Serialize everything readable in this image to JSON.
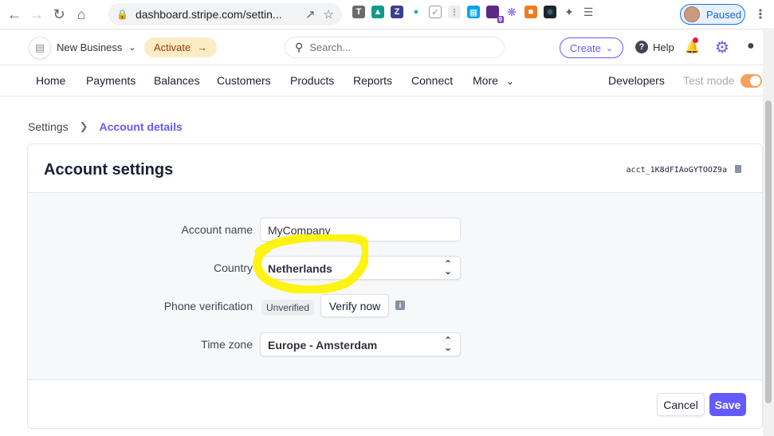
{
  "browser": {
    "url": "dashboard.stripe.com/settin...",
    "profile_status": "Paused",
    "extension_badge": "9"
  },
  "topbar": {
    "business_name": "New Business",
    "activate_label": "Activate",
    "search_placeholder": "Search...",
    "create_label": "Create",
    "help_label": "Help"
  },
  "nav": {
    "items": [
      "Home",
      "Payments",
      "Balances",
      "Customers",
      "Products",
      "Reports",
      "Connect",
      "More"
    ],
    "developers_label": "Developers",
    "test_mode_label": "Test mode"
  },
  "breadcrumb": {
    "parent": "Settings",
    "current": "Account details"
  },
  "card": {
    "title": "Account settings",
    "account_id": "acct_1K8dFIAoGYTOOZ9a",
    "fields": {
      "account_name_label": "Account name",
      "account_name_value": "MyCompany",
      "country_label": "Country",
      "country_value": "Netherlands",
      "phone_label": "Phone verification",
      "phone_status": "Unverified",
      "verify_label": "Verify now",
      "timezone_label": "Time zone",
      "timezone_value": "Europe - Amsterdam"
    },
    "cancel_label": "Cancel",
    "save_label": "Save"
  },
  "colors": {
    "accent": "#635bff",
    "highlight": "#fff200",
    "activate_bg": "#fcecc6"
  }
}
